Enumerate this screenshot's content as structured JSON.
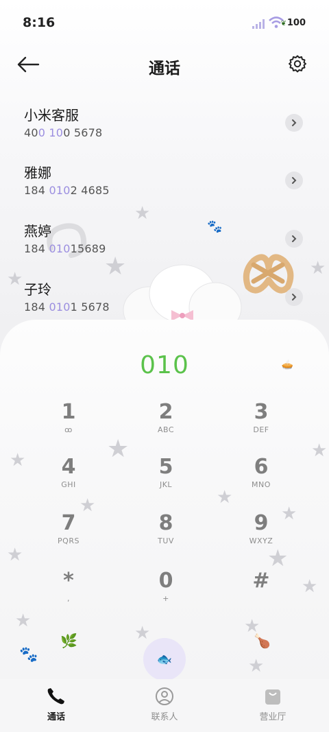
{
  "status_bar": {
    "time": "8:16",
    "battery": "100"
  },
  "header": {
    "title": "通话"
  },
  "contacts": [
    {
      "name": "小米客服",
      "num_parts": [
        "40",
        "0 10",
        "0 5678"
      ]
    },
    {
      "name": "雅娜",
      "num_parts": [
        "184 ",
        "010",
        "2 4685"
      ]
    },
    {
      "name": "燕婷",
      "num_parts": [
        "184 ",
        "010",
        "15689"
      ]
    },
    {
      "name": "子玲",
      "num_parts": [
        "184 ",
        "010",
        "1 5678"
      ]
    }
  ],
  "dialer": {
    "input": "010",
    "keys": [
      {
        "digit": "1",
        "letters": "ꝏ"
      },
      {
        "digit": "2",
        "letters": "ABC"
      },
      {
        "digit": "3",
        "letters": "DEF"
      },
      {
        "digit": "4",
        "letters": "GHI"
      },
      {
        "digit": "5",
        "letters": "JKL"
      },
      {
        "digit": "6",
        "letters": "MNO"
      },
      {
        "digit": "7",
        "letters": "PQRS"
      },
      {
        "digit": "8",
        "letters": "TUV"
      },
      {
        "digit": "9",
        "letters": "WXYZ"
      },
      {
        "digit": "*",
        "letters": ","
      },
      {
        "digit": "0",
        "letters": "+"
      },
      {
        "digit": "#",
        "letters": ""
      }
    ]
  },
  "tabs": [
    {
      "label": "通话",
      "icon": "phone-icon",
      "active": true
    },
    {
      "label": "联系人",
      "icon": "contacts-icon",
      "active": false
    },
    {
      "label": "营业厅",
      "icon": "shop-bag-icon",
      "active": false
    }
  ],
  "colors": {
    "accent_green": "#5bc24b",
    "highlight_purple": "#9b8ee0",
    "call_button_bg": "#e9e5f8"
  }
}
